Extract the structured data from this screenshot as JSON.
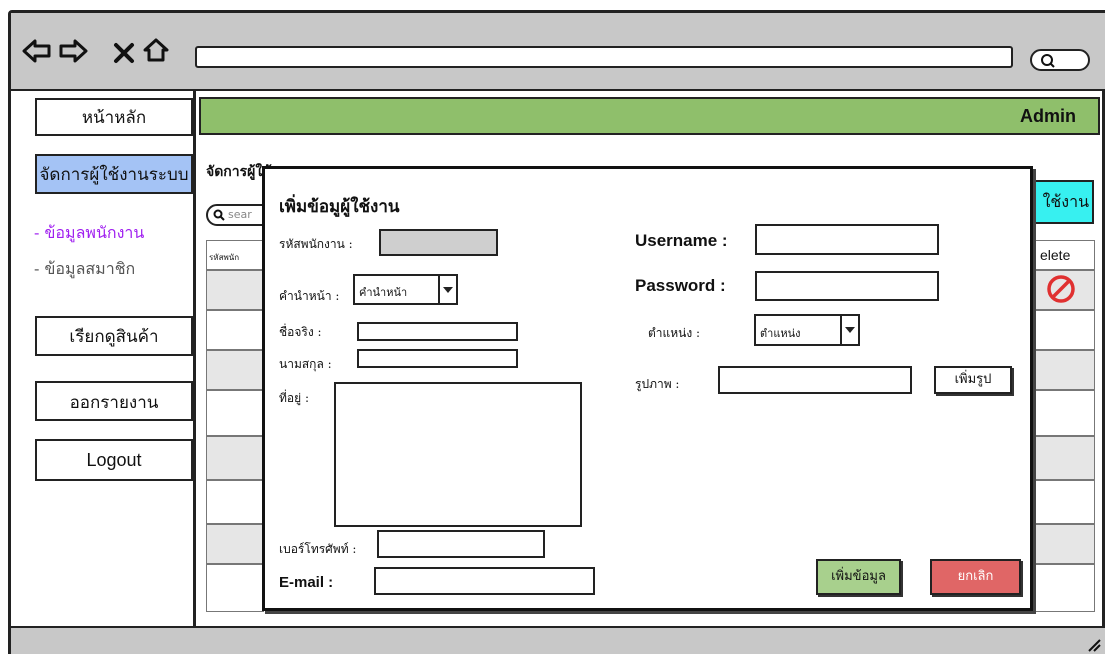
{
  "browser": {
    "nav_icons": [
      "arrow-left-icon",
      "arrow-right-icon",
      "close-icon",
      "home-icon"
    ],
    "search_icon": "search-icon"
  },
  "header": {
    "user_label": "Admin",
    "color": "#8fbf6b"
  },
  "sidebar": {
    "home": "หน้าหลัก",
    "manage_users": "จัดการผู้ใช้งานระบบ",
    "sub_employees": "- ข้อมูลพนักงาน",
    "sub_members": "- ข้อมูลสมาชิก",
    "products": "เรียกดูสินค้า",
    "reports": "ออกรายงาน",
    "logout": "Logout",
    "active_color": "#a4c3f5",
    "sub_active_color": "#a020f0"
  },
  "main": {
    "title": "จัดการผู้ใช้",
    "search_placeholder": "sear",
    "add_user_button": "ใช้งาน",
    "table_first_header": "รหัสพนัก",
    "table_last_header": "elete",
    "delete_icon": "prohibited-icon"
  },
  "modal": {
    "title": "เพิ่มข้อมูผู้ใช้งาน",
    "emp_id_label": "รหัสพนักงาน :",
    "prefix_label": "คำนำหน้า :",
    "prefix_value": "คำนำหน้า",
    "firstname_label": "ชื่อจริง :",
    "lastname_label": "นามสกุล :",
    "address_label": "ที่อยู่ :",
    "phone_label": "เบอร์โทรศัพท์ :",
    "email_label": "E-mail :",
    "username_label": "Username :",
    "password_label": "Password :",
    "position_label": "ตำแหน่ง :",
    "position_value": "ตำแหน่ง",
    "photo_label": "รูปภาพ :",
    "add_photo_button": "เพิ่มรูป",
    "submit_button": "เพิ่มข้อมูล",
    "cancel_button": "ยกเลิก",
    "submit_color": "#a8d08d",
    "cancel_color": "#e06666"
  }
}
